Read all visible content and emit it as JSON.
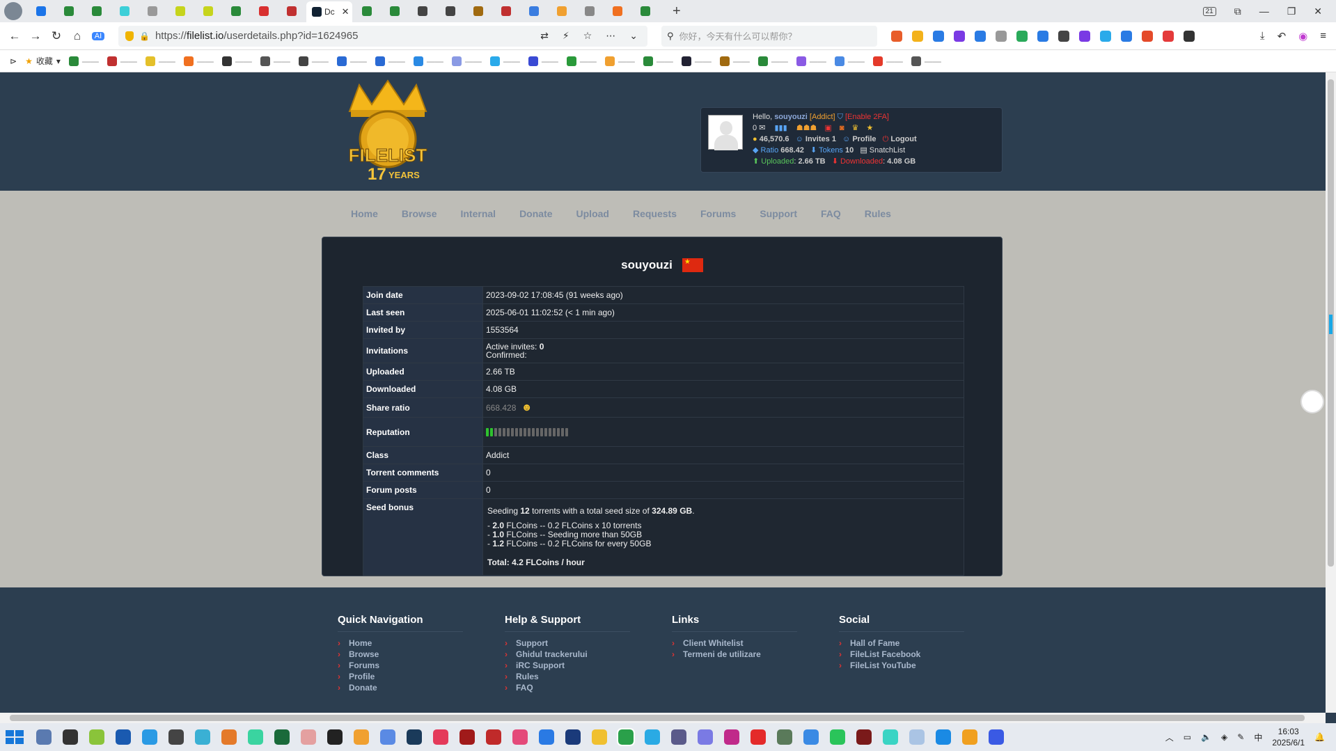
{
  "browser": {
    "active_tab_title": "Dc",
    "tab_count_badge": "21",
    "url_prefix": "https://",
    "url_domain": "filelist.io",
    "url_path": "/userdetails.php?id=1624965",
    "search_placeholder": "你好，今天有什么可以帮你？",
    "bookmarks_label": "收藏"
  },
  "userbox": {
    "greeting": "Hello, ",
    "username": "souyouzi",
    "class_label": "[Addict]",
    "enable_2fa": "[Enable 2FA]",
    "messages": "0",
    "bonus": "46,570.6",
    "invites_label": "Invites",
    "invites": "1",
    "profile_label": "Profile",
    "logout_label": "Logout",
    "ratio_label": "Ratio",
    "ratio": "668.42",
    "tokens_label": "Tokens",
    "tokens": "10",
    "snatchlist_label": "SnatchList",
    "uploaded_label": "Uploaded",
    "uploaded": "2.66 TB",
    "downloaded_label": "Downloaded",
    "downloaded": "4.08 GB"
  },
  "logo": {
    "name": "FILELIST",
    "years_num": "17",
    "years_word": "YEARS"
  },
  "nav": [
    "Home",
    "Browse",
    "Internal",
    "Donate",
    "Upload",
    "Requests",
    "Forums",
    "Support",
    "FAQ",
    "Rules"
  ],
  "profile": {
    "username": "souyouzi",
    "rows": {
      "join_date": {
        "k": "Join date",
        "v": "2023-09-02 17:08:45 (91 weeks ago)"
      },
      "last_seen": {
        "k": "Last seen",
        "v": "2025-06-01 11:02:52 (< 1 min ago)"
      },
      "invited_by": {
        "k": "Invited by",
        "v": "1553564"
      },
      "invitations": {
        "k": "Invitations",
        "active_label": "Active invites:",
        "active": "0",
        "confirmed_label": "Confirmed:"
      },
      "uploaded": {
        "k": "Uploaded",
        "v": "2.66 TB"
      },
      "downloaded": {
        "k": "Downloaded",
        "v": "4.08 GB"
      },
      "share_ratio": {
        "k": "Share ratio",
        "v": "668.428"
      },
      "reputation": {
        "k": "Reputation",
        "level_fraction": 0.1
      },
      "class": {
        "k": "Class",
        "v": "Addict"
      },
      "torrent_comments": {
        "k": "Torrent comments",
        "v": "0"
      },
      "forum_posts": {
        "k": "Forum posts",
        "v": "0"
      },
      "seed_bonus": {
        "k": "Seed bonus",
        "l1_a": "Seeding ",
        "l1_b": "12",
        "l1_c": " torrents with a total seed size of ",
        "l1_d": "324.89 GB",
        "l1_e": ".",
        "b1_a": "- ",
        "b1_b": "2.0",
        "b1_c": " FLCoins -- 0.2 FLCoins x 10 torrents",
        "b2_a": "- ",
        "b2_b": "1.0",
        "b2_c": " FLCoins -- Seeding more than 50GB",
        "b3_a": "- ",
        "b3_b": "1.2",
        "b3_c": " FLCoins -- 0.2 FLCoins for every 50GB",
        "total": "Total: 4.2 FLCoins / hour"
      }
    }
  },
  "footer": {
    "quick_nav": {
      "title": "Quick Navigation",
      "items": [
        "Home",
        "Browse",
        "Forums",
        "Profile",
        "Donate"
      ]
    },
    "help": {
      "title": "Help & Support",
      "items": [
        "Support",
        "Ghidul trackerului",
        "iRC Support",
        "Rules",
        "FAQ"
      ]
    },
    "links": {
      "title": "Links",
      "items": [
        "Client Whitelist",
        "Termeni de utilizare"
      ]
    },
    "social": {
      "title": "Social",
      "items": [
        "Hall of Fame",
        "FileList Facebook",
        "FileList YouTube"
      ]
    }
  },
  "taskbar": {
    "time": "16:03",
    "date": "2025/6/1"
  }
}
